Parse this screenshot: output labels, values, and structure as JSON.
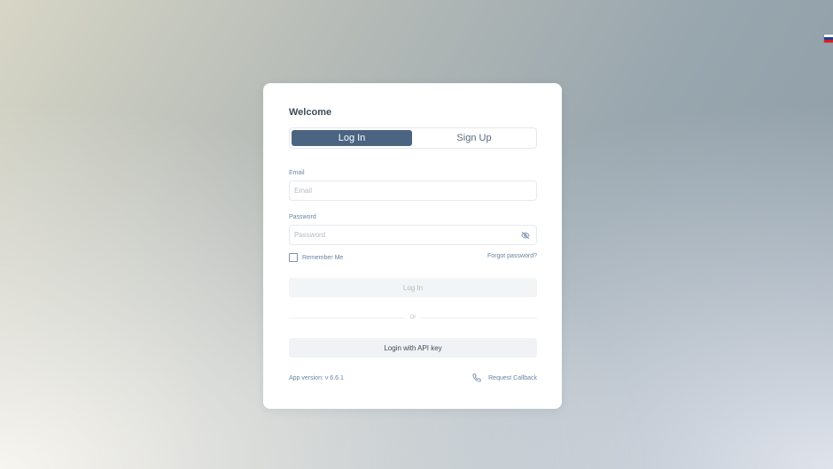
{
  "language": {
    "flag_colors": [
      "#ffffff",
      "#1c3f94",
      "#e4181c"
    ],
    "icon": "russian-flag-icon"
  },
  "form": {
    "title": "Welcome",
    "tabs": [
      {
        "label": "Log In",
        "active": true
      },
      {
        "label": "Sign Up",
        "active": false
      }
    ],
    "email": {
      "label": "Email",
      "placeholder": "Email",
      "value": ""
    },
    "password": {
      "label": "Password",
      "placeholder": "Password",
      "value": "",
      "toggle_icon": "eye-off-icon"
    },
    "remember_label": "Remember Me",
    "remember_checked": false,
    "forgot_label": "Forgot password?",
    "login_button": "Log In",
    "divider_label": "Or",
    "api_button": "Login with API key",
    "version_label": "App version: v 6.6.1",
    "callback_label": "Request Callback",
    "callback_icon": "phone-icon"
  },
  "colors": {
    "accent": "#4a6482",
    "label": "#6a84a2",
    "text": "#3d4b5c"
  }
}
